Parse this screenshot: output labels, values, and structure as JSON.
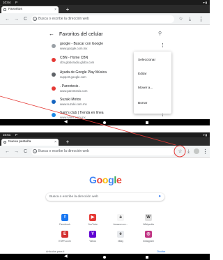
{
  "top": {
    "status": {
      "time": "10:04",
      "icon": "P",
      "indicators": "▾ ▮"
    },
    "tab": {
      "title": "Favoritos",
      "close": "×",
      "new": "+"
    },
    "omnibox": {
      "placeholder": "Busca o escribe la dirección web"
    },
    "toolbar": {
      "back": "←",
      "forward": "→",
      "reload": "C",
      "star": "☆",
      "download": "⤓",
      "menu": "⋮"
    },
    "bookmarks_header": {
      "back": "←",
      "title": "Favoritos del celular",
      "search": "⚲"
    },
    "bookmarks": [
      {
        "name": "google - Buscar con Google",
        "url": "www.google.com.mx",
        "color": "#9aa0a6"
      },
      {
        "name": "CBN - Home CBN",
        "url": "cbn.globoradio.globo.com",
        "color": "#e53935"
      },
      {
        "name": "Ayuda de Google Play Música",
        "url": "support.google.com",
        "color": "#5f6368"
      },
      {
        "name": ". Parentesis .",
        "url": "www.parentesis.com",
        "color": "#e53935"
      },
      {
        "name": "Suzuki Motos",
        "url": "www.suzuki.com.mx",
        "color": "#1565c0"
      },
      {
        "name": "Sam's club | Tienda en línea",
        "url": "www.sams.com.mx",
        "color": "#1e88e5"
      }
    ],
    "more": "⋮",
    "context_menu": [
      "Seleccionar",
      "Editar",
      "Mover a...",
      "Borrar"
    ],
    "nav": {
      "back": "◀"
    }
  },
  "bottom": {
    "status": {
      "time": "10:51",
      "icon": "P",
      "indicators": "▾ ▮"
    },
    "tab": {
      "title": "Nueva pestaña",
      "close": "×",
      "new": "+"
    },
    "omnibox": {
      "placeholder": "Busca o escribe la dirección web"
    },
    "toolbar": {
      "back": "←",
      "forward": "→",
      "reload": "C",
      "star": "☆",
      "download": "⤓",
      "menu": "⋮"
    },
    "logo": [
      "G",
      "o",
      "o",
      "g",
      "l",
      "e"
    ],
    "logo_colors": [
      "#4285f4",
      "#ea4335",
      "#fbbc05",
      "#4285f4",
      "#34a853",
      "#ea4335"
    ],
    "search": {
      "placeholder": "Busca o escribe la dirección web",
      "mic": "🎤"
    },
    "tiles": [
      {
        "label": "Facebook",
        "glyph": "f",
        "color": "#1877f2"
      },
      {
        "label": "YouTube",
        "glyph": "▶",
        "color": "#e53935"
      },
      {
        "label": "Amazon.co...",
        "glyph": "a",
        "color": "#f5f5f5"
      },
      {
        "label": "Wikipedia",
        "glyph": "W",
        "color": "#e0e0e0"
      },
      {
        "label": "ESPN.com",
        "glyph": "E",
        "color": "#d32f2f"
      },
      {
        "label": "Yahoo",
        "glyph": "Y",
        "color": "#6001d2"
      },
      {
        "label": "eBay",
        "glyph": "e",
        "color": "#e8eaed"
      },
      {
        "label": "Instagram",
        "glyph": "◎",
        "color": "#c13584"
      }
    ],
    "articles_label": "Artículos para ti",
    "articles_toggle": "Ocultar",
    "nav": {
      "back": "◀"
    }
  },
  "colors": {
    "accent": "#1a73e8",
    "pointer": "#e53935"
  }
}
